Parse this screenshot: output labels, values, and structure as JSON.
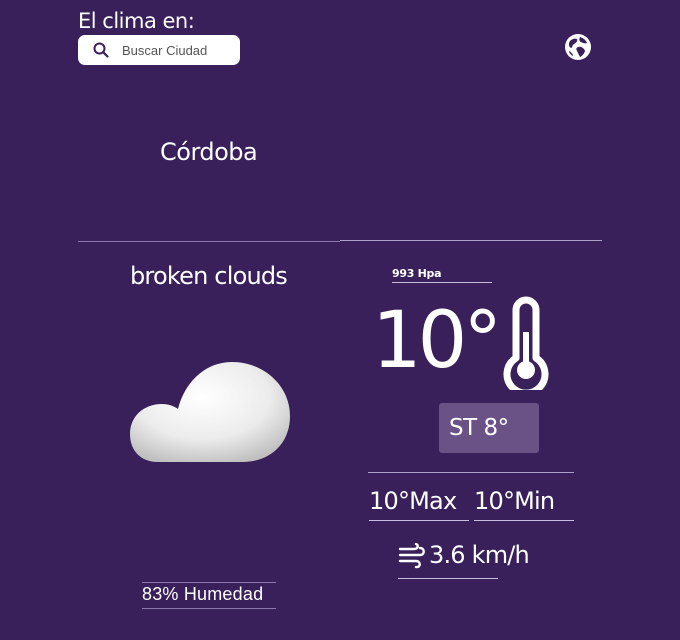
{
  "header": {
    "title": "El clima en:",
    "search_placeholder": "Buscar Ciudad",
    "search_value": ""
  },
  "location": {
    "city": "Córdoba"
  },
  "weather": {
    "description": "broken clouds",
    "pressure": "993 Hpa",
    "temperature": "10°",
    "feels_like": "ST 8°",
    "temp_max": "10°Max",
    "temp_min": "10°Min",
    "wind": "3.6 km/h",
    "humidity": "83% Humedad"
  },
  "icons": {
    "search": "search-icon",
    "globe": "globe-icon",
    "cloud": "cloud-icon",
    "thermometer": "thermometer-icon",
    "wind": "wind-icon"
  },
  "colors": {
    "background": "#39205b",
    "feels_like_box": "#6a5287",
    "text": "#ffffff"
  }
}
